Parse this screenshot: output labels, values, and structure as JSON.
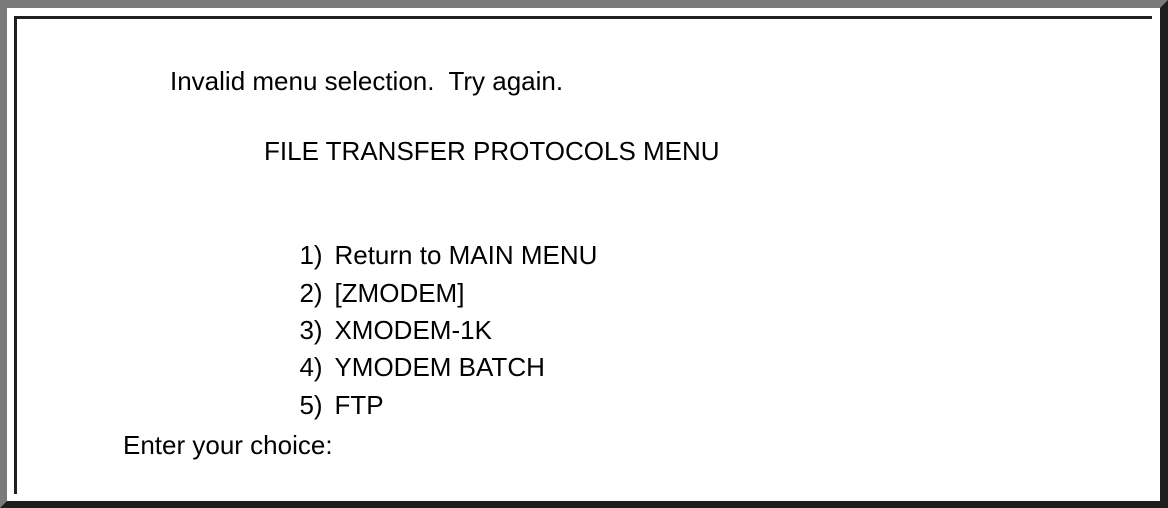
{
  "screen": {
    "error_message": "Invalid menu selection.  Try again.",
    "menu_title": "FILE TRANSFER PROTOCOLS MENU",
    "options": [
      {
        "number": "1)",
        "label": "Return to MAIN MENU"
      },
      {
        "number": "2)",
        "label": "[ZMODEM]"
      },
      {
        "number": "3)",
        "label": "XMODEM-1K"
      },
      {
        "number": "4)",
        "label": "YMODEM BATCH"
      },
      {
        "number": "5)",
        "label": "FTP"
      }
    ],
    "prompt": "Enter your choice:",
    "input_value": ""
  },
  "colors": {
    "background": "#ffffff",
    "text": "#000000",
    "border_light": "#7a7a7a",
    "border_dark": "#1e1e1e"
  }
}
